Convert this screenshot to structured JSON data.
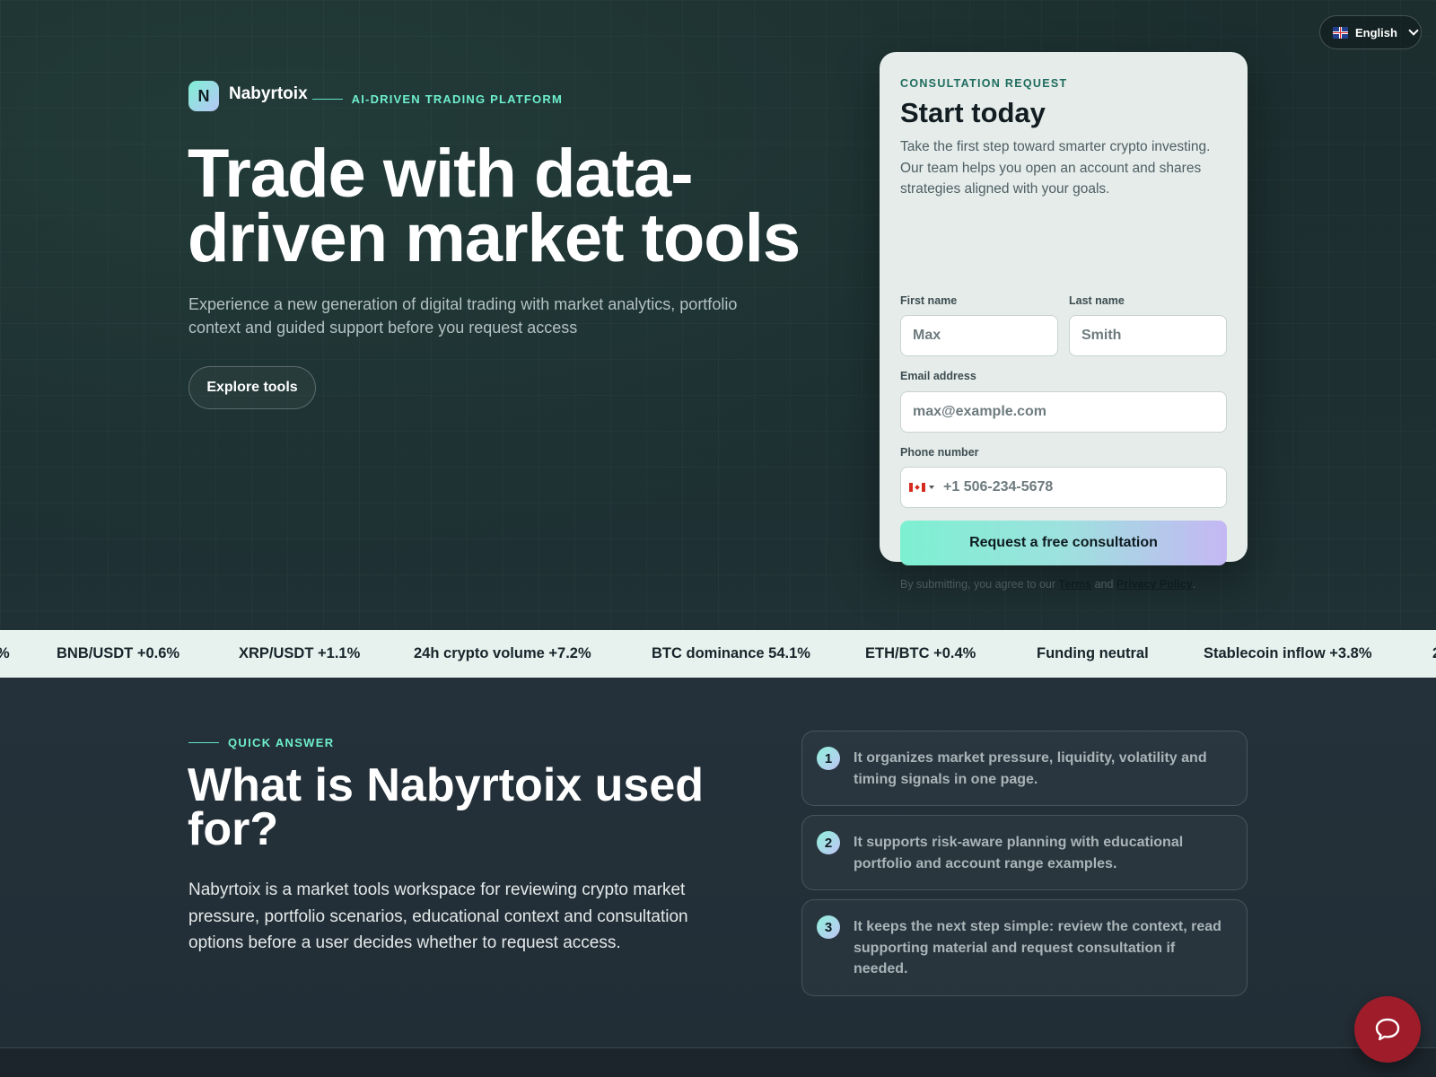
{
  "language": {
    "label": "English",
    "flag": "uk-flag-icon"
  },
  "brand": {
    "logo_letter": "N",
    "name": "Nabyrtoix",
    "tagline": "AI-DRIVEN TRADING PLATFORM"
  },
  "hero": {
    "title_line1": "Trade with data-",
    "title_line2": "driven market tools",
    "subtitle": "Experience a new generation of digital trading with market analytics, portfolio context and guided support before you request access",
    "cta_label": "Explore tools"
  },
  "form": {
    "kicker": "CONSULTATION REQUEST",
    "title": "Start today",
    "description": "Take the first step toward smarter crypto investing. Our team helps you open an account and shares strategies aligned with your goals.",
    "first_name_label": "First name",
    "first_name_placeholder": "Max",
    "last_name_label": "Last name",
    "last_name_placeholder": "Smith",
    "email_label": "Email address",
    "email_placeholder": "max@example.com",
    "phone_label": "Phone number",
    "phone_placeholder": "+1 506-234-5678",
    "phone_country_flag": "canada-flag-icon",
    "submit_label": "Request a free consultation",
    "terms_prefix": "By submitting, you agree to our",
    "terms_link": "Terms",
    "terms_and": "and",
    "privacy_link": "Privacy Policy",
    "terms_suffix": "."
  },
  "ticker": {
    "items": [
      "BNB/USDT +0.6%",
      "XRP/USDT +1.1%",
      "24h crypto volume +7.2%",
      "BTC dominance 54.1%",
      "ETH/BTC +0.4%",
      "Funding neutral",
      "Stablecoin inflow +3.8%"
    ]
  },
  "quick_answer": {
    "kicker": "QUICK ANSWER",
    "title": "What is Nabyrtoix used for?",
    "body": "Nabyrtoix is a market tools workspace for reviewing crypto market pressure, portfolio scenarios, educational context and consultation options before a user decides whether to request access.",
    "points": [
      {
        "num": "1",
        "text": "It organizes market pressure, liquidity, volatility and timing signals in one page."
      },
      {
        "num": "2",
        "text": "It supports risk-aware planning with educational portfolio and account range examples."
      },
      {
        "num": "3",
        "text": "It keeps the next step simple: review the context, read supporting material and request consultation if needed."
      }
    ]
  },
  "chat": {
    "icon": "chat-bubble-icon"
  },
  "colors": {
    "accent": "#6ef0cc",
    "card_bg": "#e5ecea",
    "ticker_bg": "#e7f2ef",
    "chat_button": "#9f1c2a"
  }
}
